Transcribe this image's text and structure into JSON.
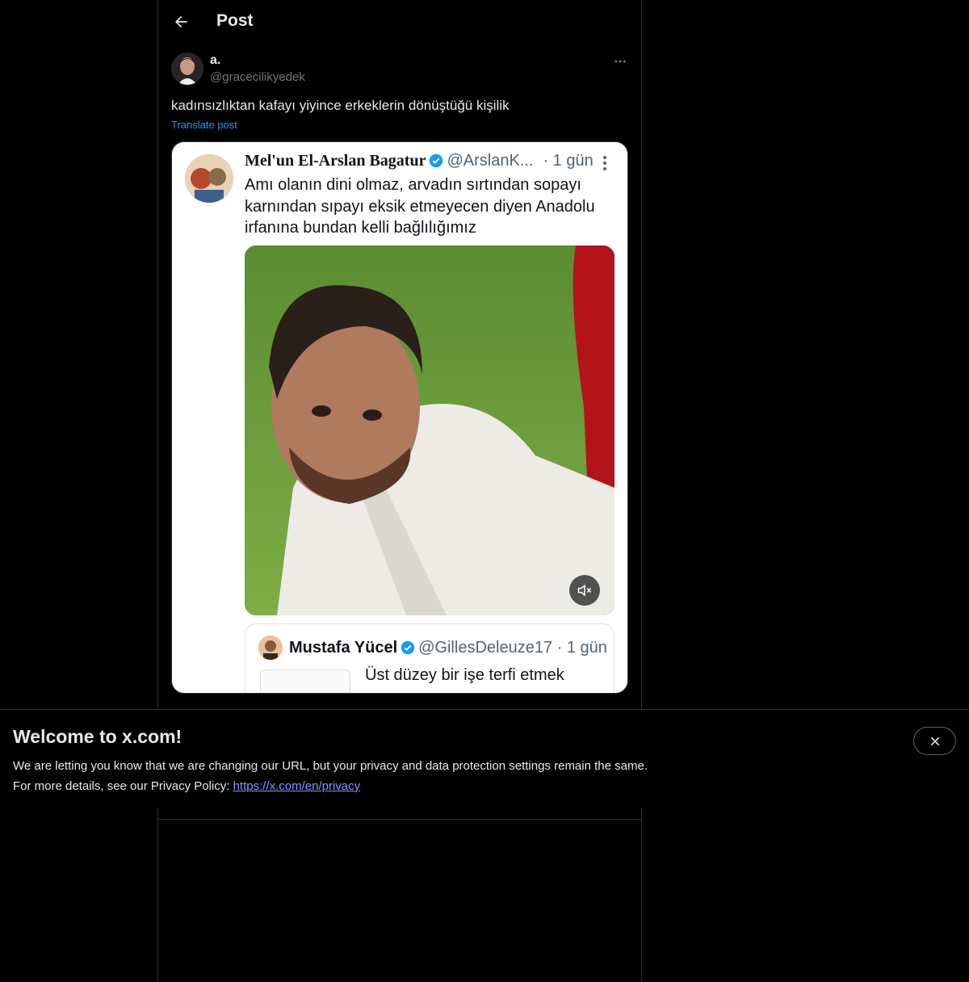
{
  "header": {
    "title": "Post",
    "back_icon": "arrow-left-icon"
  },
  "post": {
    "author_name": "a.",
    "author_handle": "@gracecilikyedek",
    "text": "kadınsızlıktan kafayı yiyince erkeklerin dönüştüğü kişilik",
    "translate_label": "Translate post",
    "more_icon": "more-horizontal-icon"
  },
  "quoted_tweet": {
    "name": "Mel'un El-Arslan Bagatur",
    "handle": "@ArslanK...",
    "time": "· 1 gün",
    "text": "Amı olanın dini olmaz, arvadın sırtından sopayı karnından sıpayı eksik etmeyecen diyen Anadolu irfanına bundan kelli bağlılığımız",
    "verified_color": "#1d9bf0"
  },
  "nested_tweet": {
    "name": "Mustafa Yücel",
    "handle": "@GillesDeleuze17",
    "time": "· 1 gün",
    "text": "Üst düzey bir işe terfi etmek"
  },
  "banner": {
    "title": "Welcome to x.com!",
    "line1": "We are letting you know that we are changing our URL, but your privacy and data protection settings remain the same.",
    "line2_prefix": "For more details, see our Privacy Policy: ",
    "link": "https://x.com/en/privacy",
    "close_icon": "close-icon"
  },
  "colors": {
    "accent": "#1d9bf0",
    "background": "#000000",
    "border": "#2f3336",
    "muted": "#71767b"
  }
}
